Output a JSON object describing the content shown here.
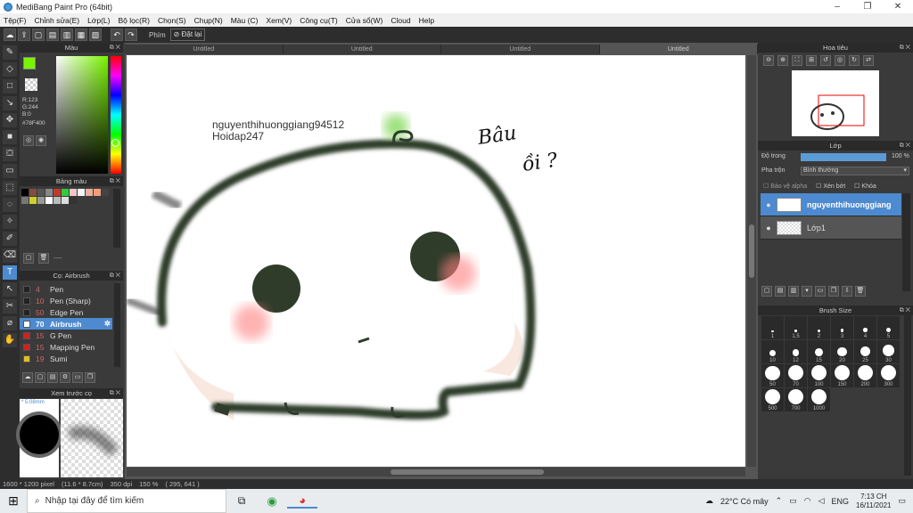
{
  "window": {
    "title": "MediBang Paint Pro (64bit)",
    "minimize": "–",
    "maximize": "❐",
    "close": "✕"
  },
  "menu": [
    "Tệp(F)",
    "Chỉnh sửa(E)",
    "Lớp(L)",
    "Bộ lọc(R)",
    "Chọn(S)",
    "Chụp(N)",
    "Màu (C)",
    "Xem(V)",
    "Công cụ(T)",
    "Cửa sổ(W)",
    "Cloud",
    "Help"
  ],
  "toolbar": {
    "phim_label": "Phím",
    "reset_label": "Đặt lại"
  },
  "color_panel": {
    "title": "Màu",
    "r": "R:123",
    "g": "G:244",
    "b": "B:0",
    "hex": "#78F400",
    "fg_color": "#78f400",
    "bg_color": "#000000"
  },
  "palette": {
    "title": "Bảng màu",
    "status": "----",
    "colors": [
      "#000000",
      "#7f4f3f",
      "#555555",
      "#888888",
      "#c0392b",
      "#2ecc40",
      "#f2c6c6",
      "#f5f5f5",
      "#e6b0a0",
      "#f39c7a",
      "#444",
      "#777",
      "#cfcf2f",
      "#999",
      "#ffffff",
      "#bbb",
      "#ddd",
      "#333"
    ]
  },
  "brush_panel": {
    "title": "Cọ: Airbrush",
    "items": [
      {
        "size": "4",
        "name": "Pen",
        "color": "#222222"
      },
      {
        "size": "10",
        "name": "Pen (Sharp)",
        "color": "#222222"
      },
      {
        "size": "50",
        "name": "Edge Pen",
        "color": "#222222"
      },
      {
        "size": "70",
        "name": "Airbrush",
        "color": "#ffffff"
      },
      {
        "size": "15",
        "name": "G Pen",
        "color": "#d02020"
      },
      {
        "size": "15",
        "name": "Mapping Pen",
        "color": "#d02020"
      },
      {
        "size": "19",
        "name": "Sumi",
        "color": "#e0c020"
      }
    ]
  },
  "preview": {
    "title": "Xem trước cọ",
    "size": "5.08mm"
  },
  "tabs": [
    "Untitled",
    "Untitled",
    "Untitled",
    "Untitled"
  ],
  "canvas": {
    "watermark1": "nguyenthihuonggiang94512",
    "watermark2": "Hoidap247",
    "handwriting1": "Bâu",
    "handwriting2": "ồi ?"
  },
  "navigator": {
    "title": "Hoa tiêu"
  },
  "layers": {
    "title": "Lớp",
    "opacity_label": "Độ trong",
    "opacity_value": "100 %",
    "opacity_pct": 100,
    "blend_label": "Pha trộn",
    "blend_value": "Bình thường",
    "protect_alpha": "Bảo vệ alpha",
    "clip": "Xén bớt",
    "lock": "Khóa",
    "items": [
      {
        "name": "nguyenthihuonggiang"
      },
      {
        "name": "Lớp1"
      }
    ]
  },
  "brush_size": {
    "title": "Brush Size",
    "sizes": [
      "1",
      "1.5",
      "2",
      "3",
      "4",
      "5",
      "10",
      "12",
      "15",
      "20",
      "25",
      "30",
      "50",
      "70",
      "100",
      "150",
      "200",
      "300",
      "500",
      "700",
      "1000"
    ]
  },
  "status": {
    "size": "1600 * 1200 pixel",
    "physical": "(11.6 * 8.7cm)",
    "dpi": "350 dpi",
    "zoom": "150 %",
    "coords": "( 295, 641 )"
  },
  "taskbar": {
    "search_placeholder": "Nhập tại đây để tìm kiếm",
    "weather": "22°C  Có mây",
    "lang": "ENG",
    "time": "7:13 CH",
    "date": "16/11/2021"
  }
}
